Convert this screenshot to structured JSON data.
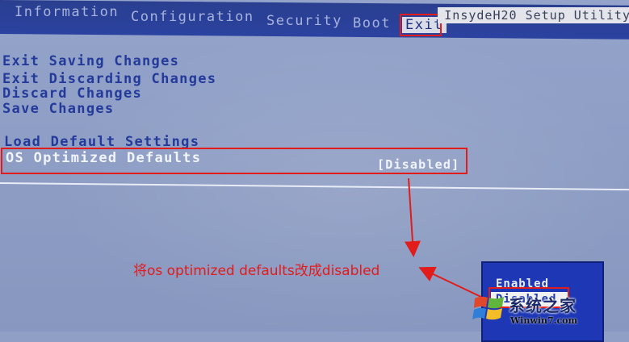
{
  "menu": {
    "tabs": [
      {
        "label": "Information"
      },
      {
        "label": "Configuration"
      },
      {
        "label": "Security"
      },
      {
        "label": "Boot"
      },
      {
        "label": "Exit"
      }
    ],
    "active_tab": "Exit",
    "brand": "InsydeH20 Setup Utility"
  },
  "options": [
    {
      "label": "Exit Saving Changes"
    },
    {
      "label": "Exit Discarding Changes"
    },
    {
      "label": "Discard Changes"
    },
    {
      "label": "Save Changes"
    },
    {
      "label": "Load Default Settings"
    },
    {
      "label": "OS Optimized Defaults",
      "value": "[Disabled]"
    }
  ],
  "popup": {
    "items": [
      "Enabled",
      "Disabled"
    ],
    "selected": "Disabled"
  },
  "annotation": "将os optimized defaults改成disabled",
  "watermark": {
    "text": "系统之家",
    "url": "Winwin7.com"
  },
  "colors": {
    "annotation": "#e21b1b",
    "menu_bg": "#2a3f8f",
    "option_text": "#233a9b",
    "popup_bg": "#1d37b5"
  }
}
